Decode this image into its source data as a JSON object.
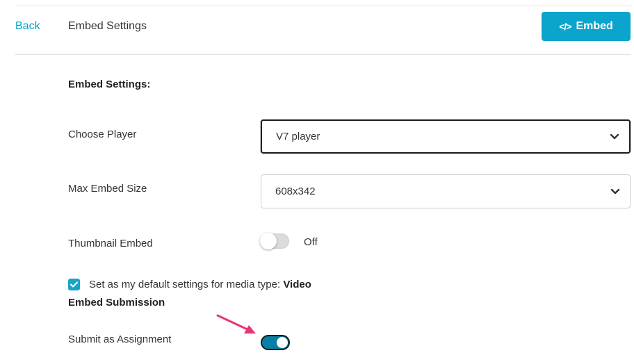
{
  "header": {
    "back_label": "Back",
    "title": "Embed Settings",
    "embed_button": {
      "icon": "code-icon",
      "icon_glyph": "</>",
      "label": "Embed",
      "color": "#0aa4cc"
    }
  },
  "form": {
    "heading": "Embed Settings:",
    "choose_player": {
      "label": "Choose Player",
      "value": "V7 player"
    },
    "max_embed_size": {
      "label": "Max Embed Size",
      "value": "608x342"
    },
    "thumbnail_embed": {
      "label": "Thumbnail Embed",
      "state": "Off",
      "enabled": false
    },
    "default_settings": {
      "checked": true,
      "text": "Set as my default settings for media type:",
      "media_type": "Video"
    }
  },
  "submission": {
    "heading": "Embed Submission",
    "submit_as_assignment": {
      "label": "Submit as Assignment",
      "enabled": true
    }
  },
  "annotation": {
    "icon": "arrow-icon",
    "color": "#e8357a"
  },
  "colors": {
    "accent": "#00a0c6",
    "toggle_on": "#0a7fa6"
  }
}
